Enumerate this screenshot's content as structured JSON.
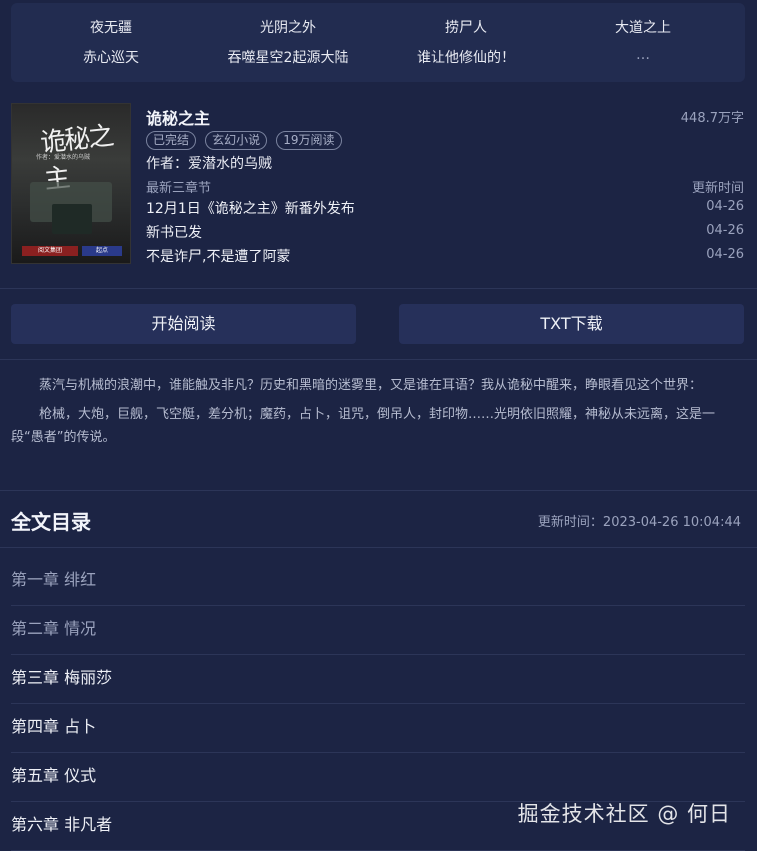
{
  "related": {
    "row1": [
      "夜无疆",
      "光阴之外",
      "捞尸人",
      "大道之上"
    ],
    "row2": [
      "赤心巡天",
      "吞噬星空2起源大陆",
      "谁让他修仙的！"
    ],
    "more": "…"
  },
  "book": {
    "cover_title": "诡秘之主",
    "cover_sub": "作者：爱潜水的乌贼",
    "cover_badge_left": "阅文集团",
    "cover_badge_right": "起点",
    "title": "诡秘之主",
    "word_count": "448.7万字",
    "tags": [
      "已完结",
      "玄幻小说",
      "19万阅读"
    ],
    "author": "作者：爱潜水的乌贼",
    "latest_label": "最新三章节",
    "update_label": "更新时间",
    "latest": [
      {
        "name": "12月1日《诡秘之主》新番外发布",
        "date": "04-26"
      },
      {
        "name": "新书已发",
        "date": "04-26"
      },
      {
        "name": "不是诈尸,不是遭了阿蒙",
        "date": "04-26"
      }
    ]
  },
  "actions": {
    "read_label": "开始阅读",
    "download_label": "TXT下载"
  },
  "intro": [
    "蒸汽与机械的浪潮中，谁能触及非凡？历史和黑暗的迷雾里，又是谁在耳语？我从诡秘中醒来，睁眼看见这个世界：",
    "枪械，大炮，巨舰，飞空艇，差分机；魔药，占卜，诅咒，倒吊人，封印物……光明依旧照耀，神秘从未远离，这是一段“愚者”的传说。"
  ],
  "toc": {
    "title": "全文目录",
    "update_time": "更新时间：2023-04-26 10:04:44",
    "chapters": [
      {
        "name": "第一章 绯红",
        "read": true
      },
      {
        "name": "第二章 情况",
        "read": true
      },
      {
        "name": "第三章 梅丽莎",
        "read": false
      },
      {
        "name": "第四章 占卜",
        "read": false
      },
      {
        "name": "第五章 仪式",
        "read": false
      },
      {
        "name": "第六章 非凡者",
        "read": false
      }
    ]
  },
  "watermark": "掘金技术社区 @ 何日"
}
